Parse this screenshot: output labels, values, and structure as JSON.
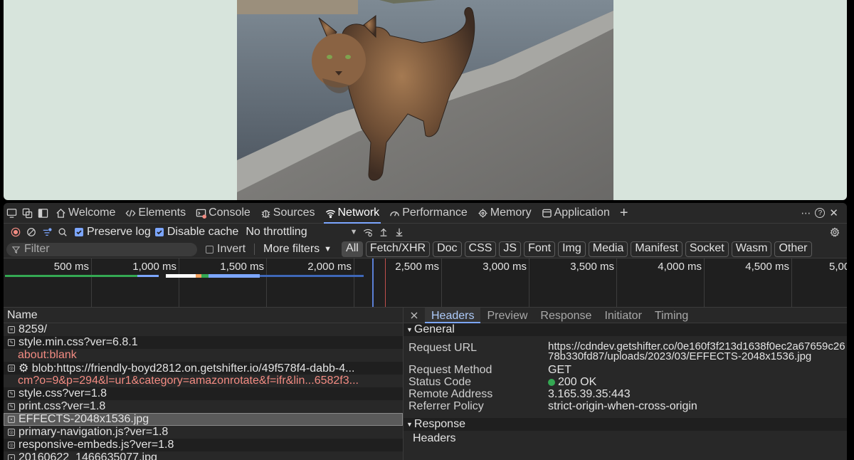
{
  "main_tabs": [
    {
      "label": "Welcome",
      "icon": "home-icon"
    },
    {
      "label": "Elements",
      "icon": "code-icon"
    },
    {
      "label": "Console",
      "icon": "console-icon"
    },
    {
      "label": "Sources",
      "icon": "bug-icon"
    },
    {
      "label": "Network",
      "icon": "wifi-icon",
      "active": true
    },
    {
      "label": "Performance",
      "icon": "gauge-icon"
    },
    {
      "label": "Memory",
      "icon": "memory-icon"
    },
    {
      "label": "Application",
      "icon": "app-icon"
    }
  ],
  "toolbar": {
    "preserve_log": "Preserve log",
    "disable_cache": "Disable cache",
    "throttling": "No throttling"
  },
  "filter": {
    "placeholder": "Filter",
    "invert": "Invert",
    "more_filters": "More filters",
    "chips": [
      "All",
      "Fetch/XHR",
      "Doc",
      "CSS",
      "JS",
      "Font",
      "Img",
      "Media",
      "Manifest",
      "Socket",
      "Wasm",
      "Other"
    ]
  },
  "timeline": {
    "ticks": [
      "500 ms",
      "1,000 ms",
      "1,500 ms",
      "2,000 ms",
      "2,500 ms",
      "3,000 ms",
      "3,500 ms",
      "4,000 ms",
      "4,500 ms",
      "5,00"
    ]
  },
  "requests": {
    "header": "Name",
    "rows": [
      {
        "name": "8259/"
      },
      {
        "name": "style.min.css?ver=6.8.1"
      },
      {
        "name": "about:blank"
      },
      {
        "name": "⚙ blob:https://friendly-boyd2812.on.getshifter.io/49f578f4-dabb-4..."
      },
      {
        "name": "cm?o=9&p=294&l=ur1&category=amazonrotate&f=ifr&lin...6582f3..."
      },
      {
        "name": "style.css?ver=1.8"
      },
      {
        "name": "print.css?ver=1.8"
      },
      {
        "name": "EFFECTS-2048x1536.jpg"
      },
      {
        "name": "primary-navigation.js?ver=1.8"
      },
      {
        "name": "responsive-embeds.js?ver=1.8"
      },
      {
        "name": "20160622_1466635077.jpg"
      }
    ]
  },
  "details": {
    "tabs": [
      "Headers",
      "Preview",
      "Response",
      "Initiator",
      "Timing"
    ],
    "general_label": "General",
    "fields": [
      {
        "key": "Request URL",
        "value": "https://cdndev.getshifter.co/0e160f3f213d1638f0ec2a67659c2678b330fd87/uploads/2023/03/EFFECTS-2048x1536.jpg"
      },
      {
        "key": "Request Method",
        "value": "GET"
      },
      {
        "key": "Status Code",
        "value": "200 OK"
      },
      {
        "key": "Remote Address",
        "value": "3.165.39.35:443"
      },
      {
        "key": "Referrer Policy",
        "value": "strict-origin-when-cross-origin"
      }
    ],
    "response_label": "Response",
    "response_sub": "Headers"
  },
  "colors": {
    "accent": "#7ca6ff",
    "status_ok": "#34a853",
    "error_text": "#f28b82",
    "viewport_bg": "#d7e4dc"
  }
}
